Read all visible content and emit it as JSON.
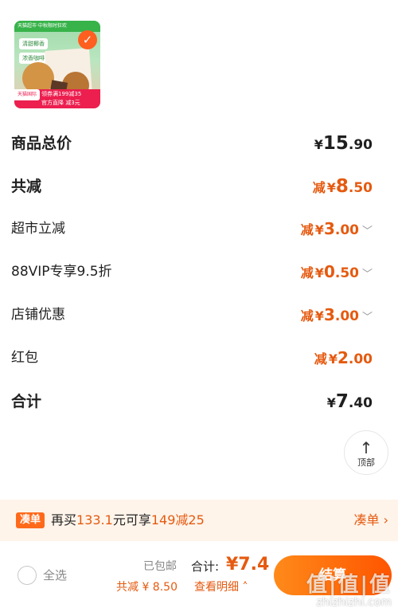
{
  "product": {
    "banner": "天猫超市·中秋限时狂欢",
    "tag1": "清甜椰香",
    "tag2": "浓香咖啡",
    "badge": "天猫国际",
    "coupon_line1": "领券满199减35",
    "coupon_line2": "官方直降 减3元",
    "check_glyph": "✓"
  },
  "summary": {
    "total_price": {
      "label": "商品总价",
      "yen": "¥",
      "int": "15",
      "dec": ".90"
    },
    "total_discount": {
      "label": "共减",
      "prefix": "减",
      "yen": "¥",
      "int": "8",
      "dec": ".50"
    },
    "items": [
      {
        "label": "超市立减",
        "prefix": "减",
        "yen": "¥",
        "int": "3",
        "dec": ".00",
        "chevron": "﹀"
      },
      {
        "label": "88VIP专享9.5折",
        "prefix": "减",
        "yen": "¥",
        "int": "0",
        "dec": ".50",
        "chevron": "﹀"
      },
      {
        "label": "店铺优惠",
        "prefix": "减",
        "yen": "¥",
        "int": "3",
        "dec": ".00",
        "chevron": "﹀"
      },
      {
        "label": "红包",
        "prefix": "减",
        "yen": "¥",
        "int": "2",
        "dec": ".00"
      }
    ],
    "grand_total": {
      "label": "合计",
      "yen": "¥",
      "int": "7",
      "dec": ".40"
    }
  },
  "top_button": {
    "arrow": "↑",
    "label": "顶部"
  },
  "promo": {
    "tag": "凑单",
    "text_prefix": "再买",
    "amount": "133.1",
    "text_mid": "元可享",
    "offer": "149减25",
    "link": "凑单 ›"
  },
  "bottom": {
    "select_all": "全选",
    "shipping": "已包邮",
    "total_label": "合计:",
    "total_value": "¥7.4",
    "discount_line": "共减 ¥ 8.50",
    "detail_link": "查看明细 ˄",
    "checkout": "结算",
    "watermark_main": "值|值|值",
    "watermark_sub": "zhizhizhi.com"
  },
  "colors": {
    "accent": "#e55a10",
    "checkout_gradient_start": "#ff8a1a",
    "checkout_gradient_end": "#ff5500",
    "promo_bg": "#fff4ea"
  }
}
